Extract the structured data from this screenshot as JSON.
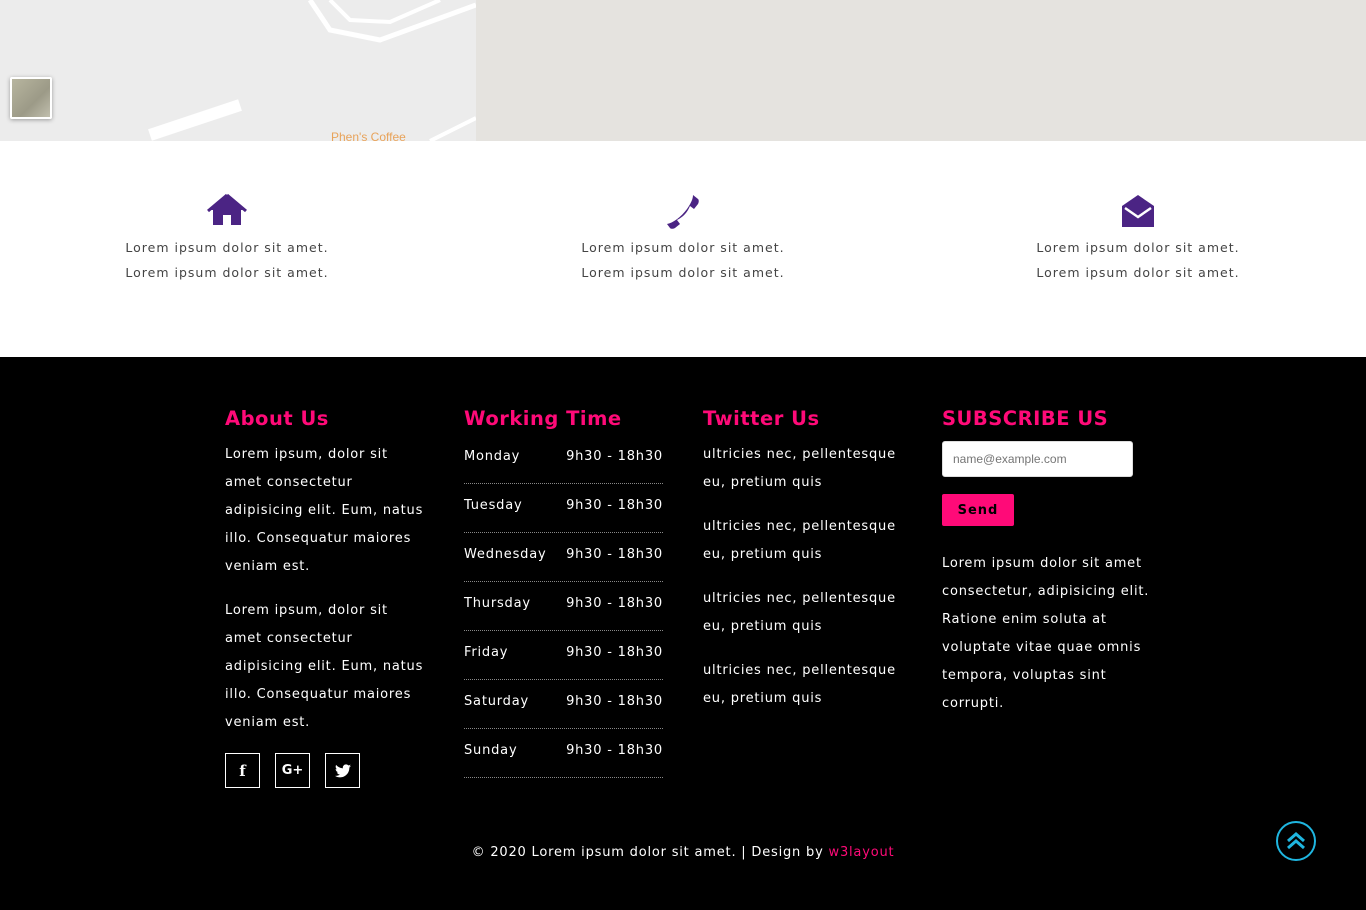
{
  "map": {
    "place_label": "Phen's Coffee"
  },
  "contact": {
    "items": [
      {
        "icon": "home-icon",
        "line1": "Lorem ipsum dolor sit amet.",
        "line2": "Lorem ipsum dolor sit amet."
      },
      {
        "icon": "phone-icon",
        "line1": "Lorem ipsum dolor sit amet.",
        "line2": "Lorem ipsum dolor sit amet."
      },
      {
        "icon": "envelope-icon",
        "line1": "Lorem ipsum dolor sit amet.",
        "line2": "Lorem ipsum dolor sit amet."
      }
    ],
    "icon_color": "#4b2484"
  },
  "footer": {
    "accent_color": "#ff0a78",
    "about": {
      "title": "About Us",
      "paragraphs": [
        "Lorem ipsum, dolor sit amet consectetur adipisicing elit. Eum, natus illo. Consequatur maiores veniam est.",
        "Lorem ipsum, dolor sit amet consectetur adipisicing elit. Eum, natus illo. Consequatur maiores veniam est."
      ],
      "social": [
        {
          "icon": "facebook-icon",
          "glyph": "f"
        },
        {
          "icon": "google-plus-icon",
          "glyph": "G+"
        },
        {
          "icon": "twitter-icon",
          "glyph": "t"
        }
      ]
    },
    "hours": {
      "title": "Working Time",
      "rows": [
        {
          "day": "Monday",
          "time": "9h30 - 18h30"
        },
        {
          "day": "Tuesday",
          "time": "9h30 - 18h30"
        },
        {
          "day": "Wednesday",
          "time": "9h30 - 18h30"
        },
        {
          "day": "Thursday",
          "time": "9h30 - 18h30"
        },
        {
          "day": "Friday",
          "time": "9h30 - 18h30"
        },
        {
          "day": "Saturday",
          "time": "9h30 - 18h30"
        },
        {
          "day": "Sunday",
          "time": "9h30 - 18h30"
        }
      ]
    },
    "twitter": {
      "title": "Twitter Us",
      "tweets": [
        "ultricies nec, pellentesque eu, pretium quis",
        "ultricies nec, pellentesque eu, pretium quis",
        "ultricies nec, pellentesque eu, pretium quis",
        "ultricies nec, pellentesque eu, pretium quis"
      ]
    },
    "subscribe": {
      "title": "SUBSCRIBE US",
      "placeholder": "name@example.com",
      "button": "Send",
      "text": "Lorem ipsum dolor sit amet consectetur, adipisicing elit. Ratione enim soluta at voluptate vitae quae omnis tempora, voluptas sint corrupti."
    },
    "copyright": {
      "text": "© 2020 Lorem ipsum dolor sit amet. | Design by ",
      "link": "w3layout"
    },
    "to_top_color": "#1fb6e0"
  }
}
